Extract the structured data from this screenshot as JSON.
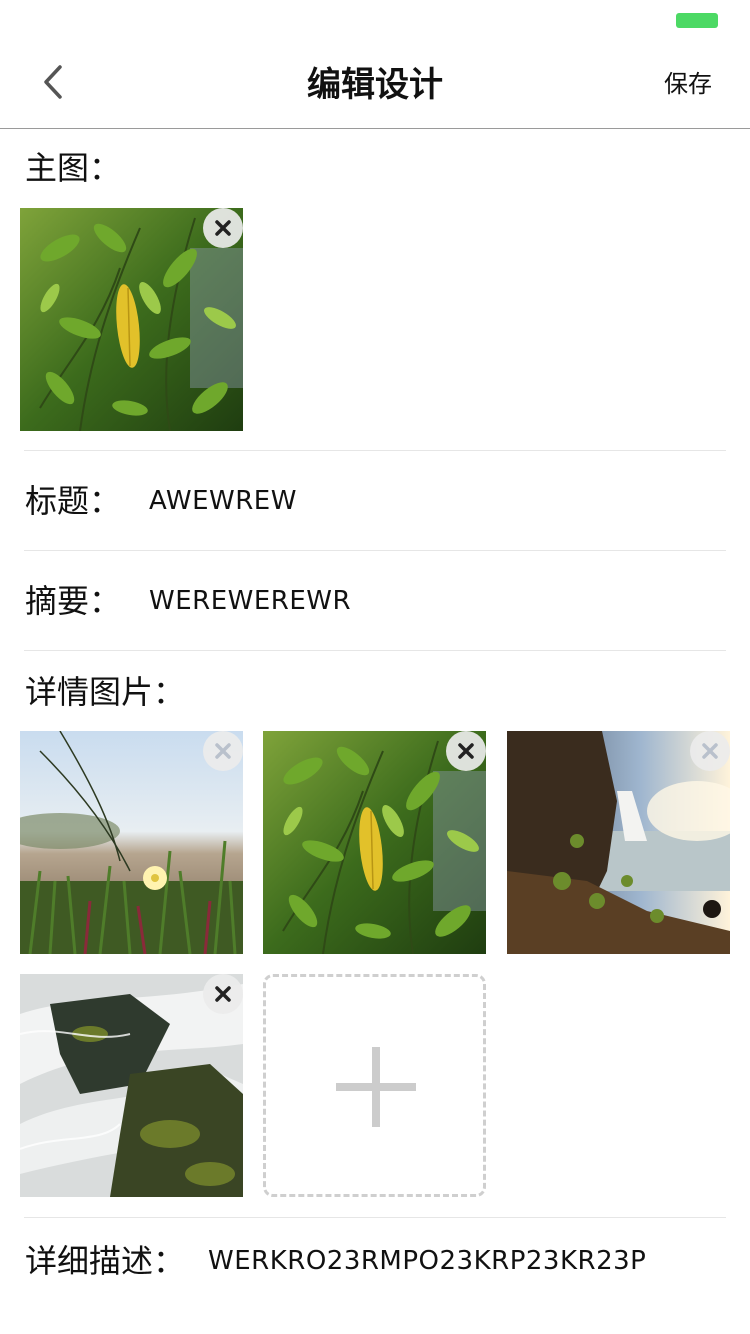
{
  "nav": {
    "title": "编辑设计",
    "save_label": "保存",
    "back_icon": "chevron-left-icon"
  },
  "status": {
    "battery_color": "#4cd964"
  },
  "main_image": {
    "label": "主图：",
    "image": "leaf-photo"
  },
  "title_field": {
    "label": "标题：",
    "value": "AWEWREW"
  },
  "summary_field": {
    "label": "摘要：",
    "value": "WEREWEREWR"
  },
  "detail_images": {
    "label": "详情图片：",
    "images": [
      {
        "name": "grass-flower-photo"
      },
      {
        "name": "leaf-photo"
      },
      {
        "name": "waterfall-cliff-photo"
      },
      {
        "name": "stream-rocks-photo"
      }
    ],
    "add_icon": "plus-icon"
  },
  "description_field": {
    "label": "详细描述：",
    "value": "WERKRO23RMPO23KRP23KR23P"
  },
  "colors": {
    "divider": "#e6e6e6",
    "nav_border": "#9a9a9a",
    "dashed_border": "#cfcfcf",
    "accent_green": "#4cd964"
  }
}
